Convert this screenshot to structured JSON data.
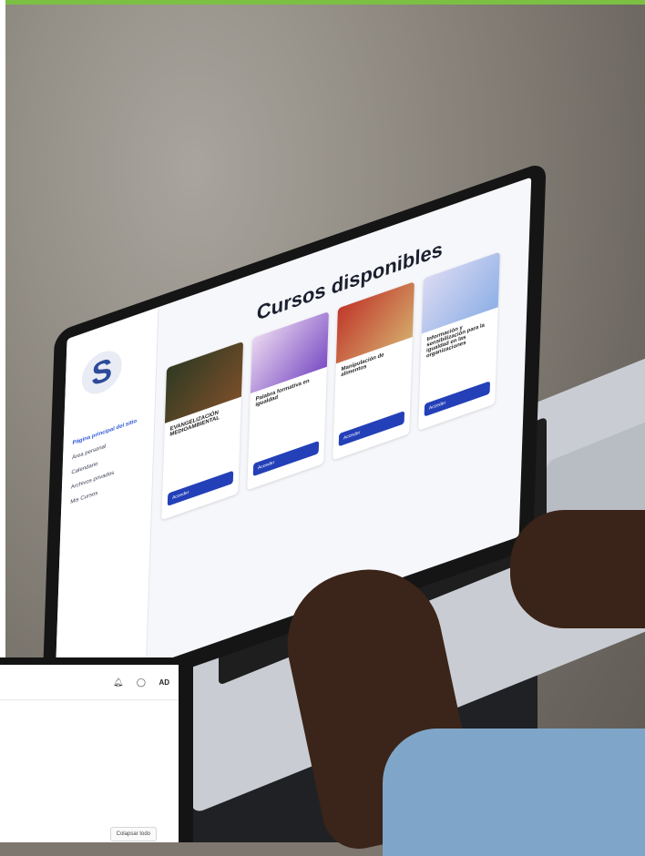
{
  "photo": {
    "laptop_screen": {
      "title": "Cursos disponibles",
      "sidebar_items": [
        "Página principal del sitio",
        "Área personal",
        "Calendario",
        "Archivos privados",
        "Mis Cursos"
      ],
      "cards": [
        {
          "title": "EVANGELIZACIÓN MEDIOAMBIENTAL",
          "button": "Acceder"
        },
        {
          "title": "Palabra formativa en igualdad",
          "button": "Acceder"
        },
        {
          "title": "Manipulación de alimentos",
          "button": "Acceder"
        },
        {
          "title": "Información y sensibilización para la igualdad en las organizaciones",
          "button": "Acceder"
        }
      ]
    },
    "foreground_screen": {
      "avatar": "AD",
      "collapse_button": "Colapsar todo"
    }
  },
  "colors": {
    "accent_top_bar": "#7bc043",
    "button_blue": "#2340b8"
  }
}
